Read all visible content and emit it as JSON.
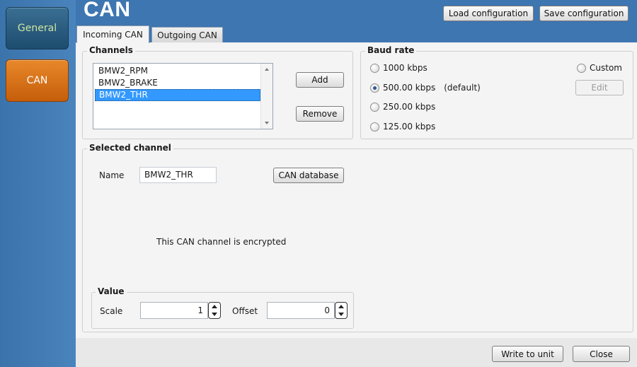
{
  "sidebar": {
    "items": [
      {
        "label": "General"
      },
      {
        "label": "CAN"
      }
    ]
  },
  "header": {
    "title": "CAN",
    "load_label": "Load configuration",
    "save_label": "Save configuration"
  },
  "tabs": [
    {
      "label": "Incoming CAN",
      "selected": true
    },
    {
      "label": "Outgoing CAN",
      "selected": false
    }
  ],
  "channels": {
    "title": "Channels",
    "items": [
      "BMW2_RPM",
      "BMW2_BRAKE",
      "BMW2_THR"
    ],
    "selected_index": 2,
    "add_label": "Add",
    "remove_label": "Remove"
  },
  "baud": {
    "title": "Baud rate",
    "options": [
      "1000 kbps",
      "500.00 kbps",
      "250.00 kbps",
      "125.00 kbps"
    ],
    "default_note": "(default)",
    "selected": "500.00 kbps",
    "custom_label": "Custom",
    "edit_label": "Edit"
  },
  "selected_channel": {
    "title": "Selected channel",
    "name_label": "Name",
    "name_value": "BMW2_THR",
    "can_database_label": "CAN database",
    "encrypted_note": "This CAN channel is encrypted",
    "value": {
      "title": "Value",
      "scale_label": "Scale",
      "scale_value": "1",
      "offset_label": "Offset",
      "offset_value": "0"
    }
  },
  "footer": {
    "write_label": "Write to unit",
    "close_label": "Close"
  },
  "colors": {
    "background": "#3d76b0",
    "general_nav": "#1d4c6e",
    "can_nav_active": "#e07a1f",
    "selection": "#3399ff"
  }
}
